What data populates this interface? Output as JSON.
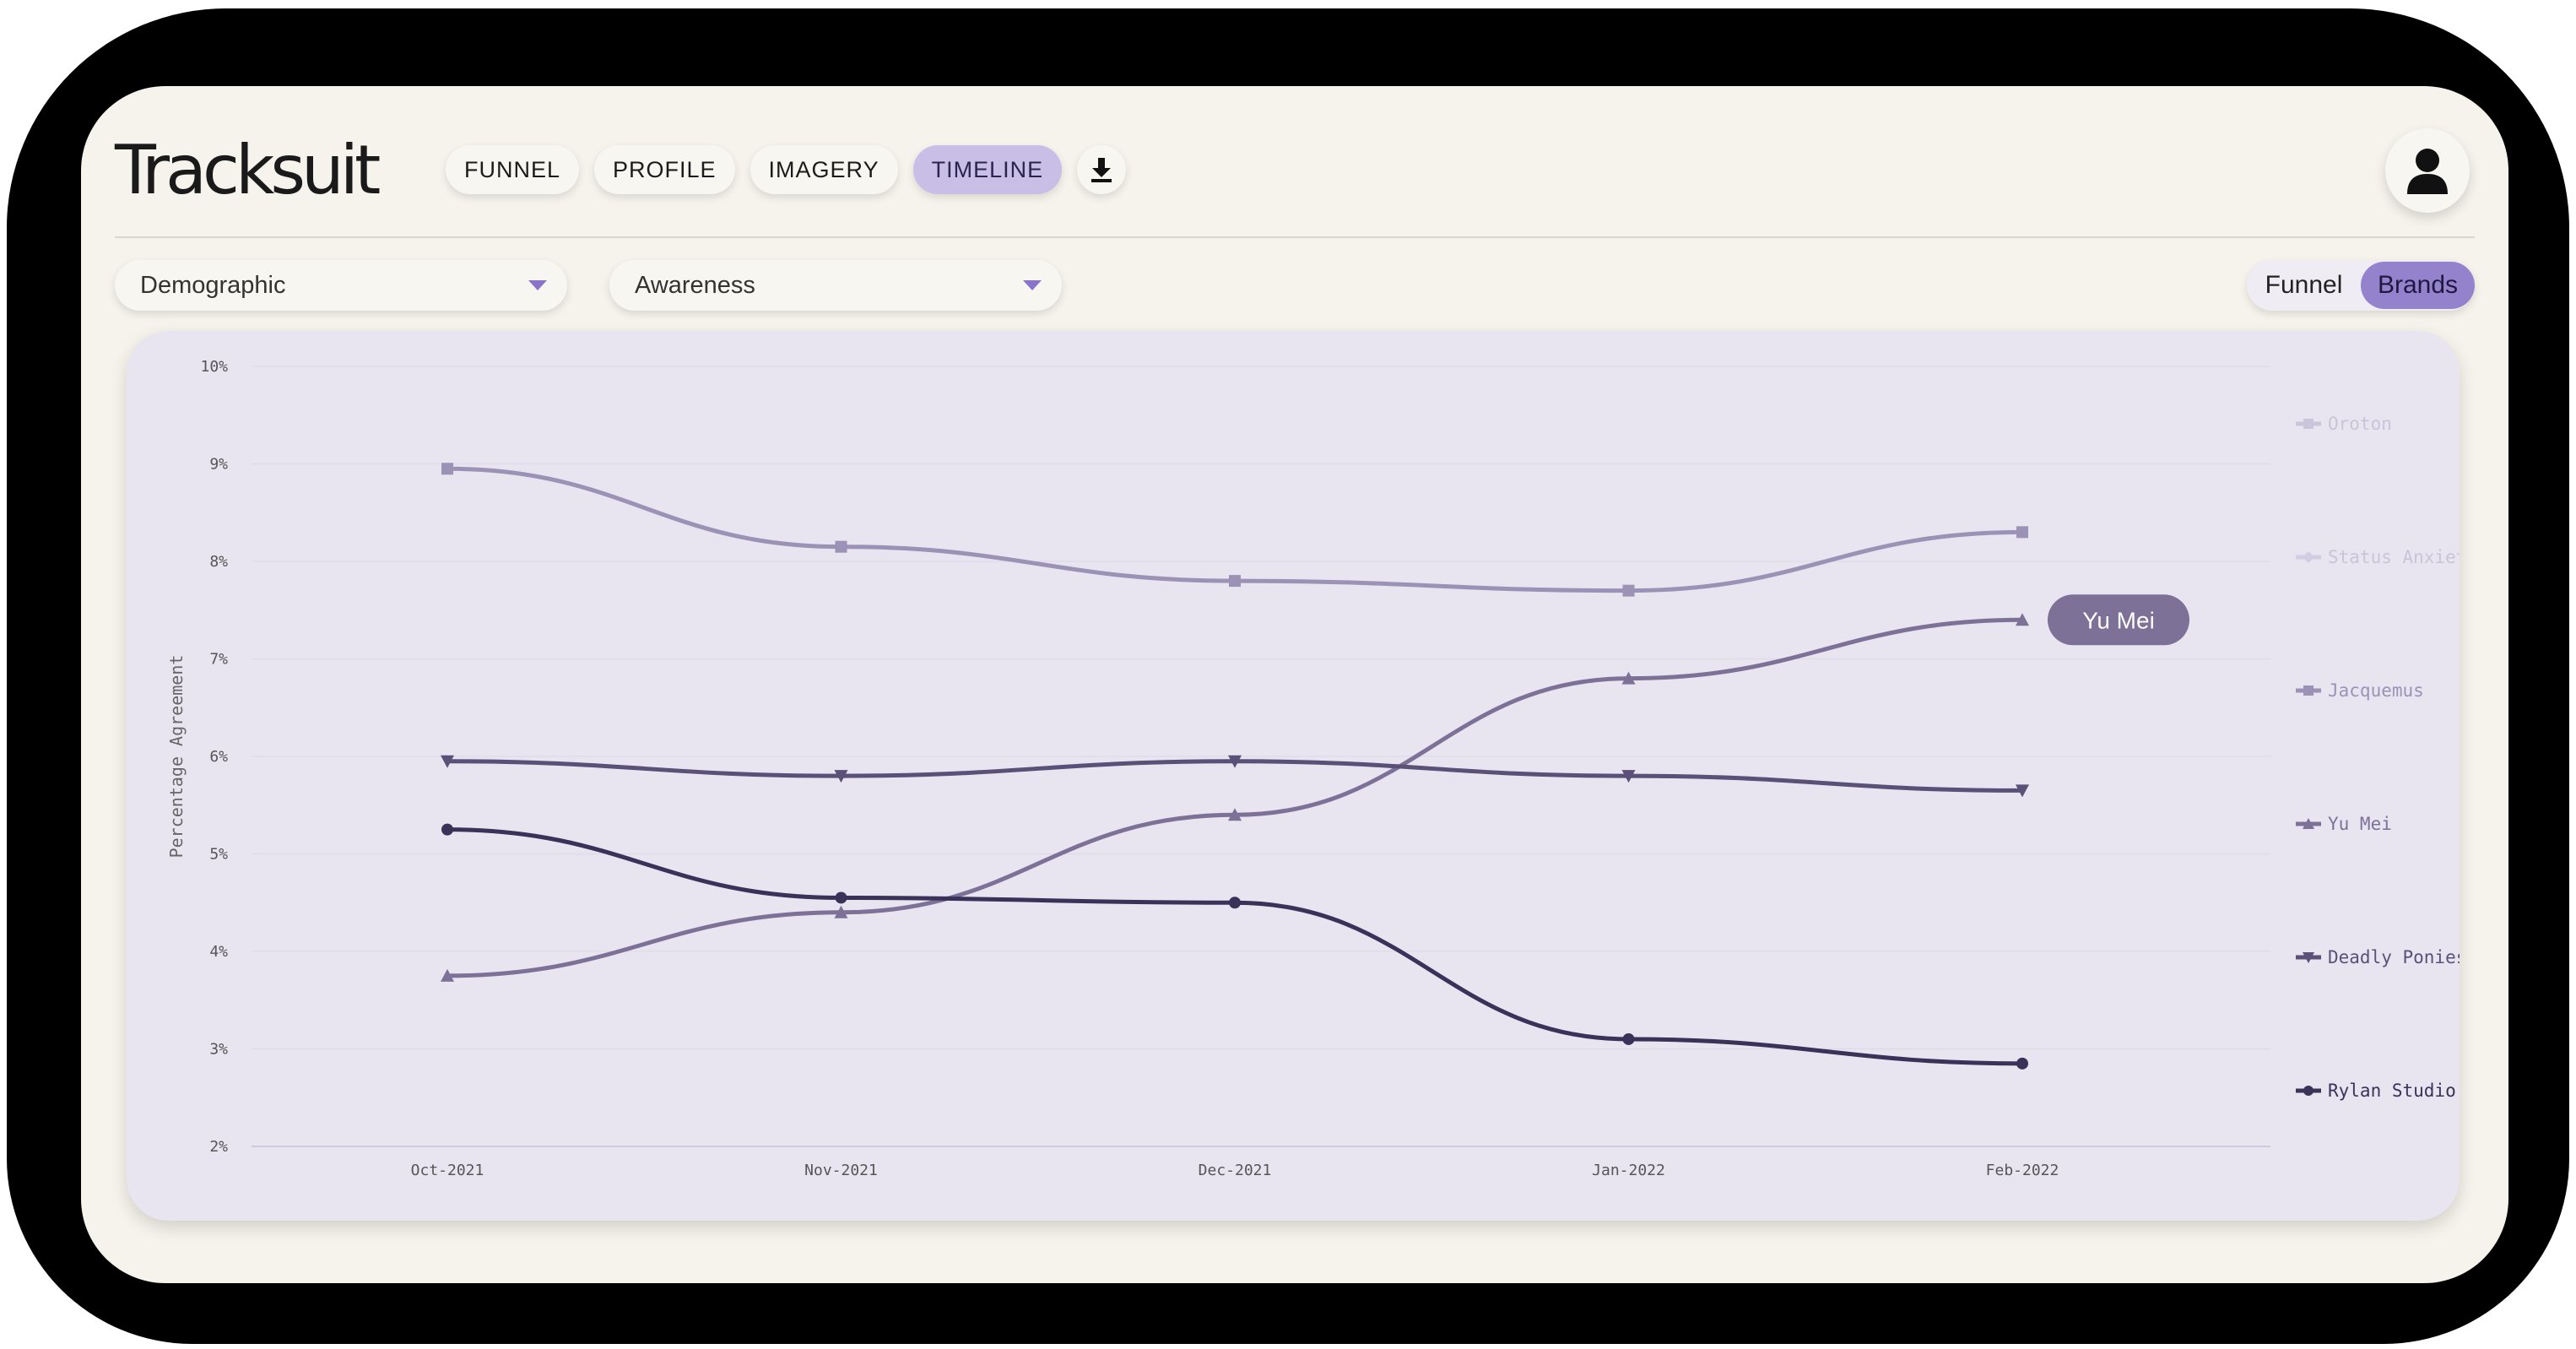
{
  "app": {
    "logo": "Tracksuit"
  },
  "nav": {
    "tabs": [
      {
        "label": "FUNNEL",
        "active": false
      },
      {
        "label": "PROFILE",
        "active": false
      },
      {
        "label": "IMAGERY",
        "active": false
      },
      {
        "label": "TIMELINE",
        "active": true
      }
    ],
    "download_icon": "download-icon",
    "user_icon": "user-icon"
  },
  "filters": {
    "demographic": "Demographic",
    "metric": "Awareness"
  },
  "view_toggle": {
    "options": [
      "Funnel",
      "Brands"
    ],
    "selected": "Brands"
  },
  "colors": {
    "accent": "#9483cc",
    "active_tab": "#c8bee6",
    "background": "#f6f3ec",
    "card": "#e8e5f0"
  },
  "chart_data": {
    "type": "line",
    "ylabel": "Percentage Agreement",
    "xlabel": "",
    "ylim": [
      2,
      10
    ],
    "yticks": [
      "10%",
      "9%",
      "8%",
      "7%",
      "6%",
      "5%",
      "4%",
      "3%",
      "2%"
    ],
    "categories": [
      "Oct-2021",
      "Nov-2021",
      "Dec-2021",
      "Jan-2022",
      "Feb-2022"
    ],
    "legend_placement": "right",
    "tooltip": {
      "label": "Yu Mei",
      "series": "Yu Mei",
      "category": "Feb-2022"
    },
    "series": [
      {
        "name": "Oroton",
        "values": [],
        "color": "#cbc5dc",
        "marker": "square",
        "faded": true
      },
      {
        "name": "Status Anxiety",
        "values": [],
        "color": "#d2cde2",
        "marker": "diamond",
        "faded": true
      },
      {
        "name": "Jacquemus",
        "values": [
          8.95,
          8.15,
          7.8,
          7.7,
          8.3
        ],
        "color": "#9c92b6",
        "marker": "square",
        "faded": false
      },
      {
        "name": "Yu Mei",
        "values": [
          3.75,
          4.4,
          5.4,
          6.8,
          7.4
        ],
        "color": "#7d7198",
        "marker": "triangle",
        "faded": false
      },
      {
        "name": "Deadly Ponies",
        "values": [
          5.95,
          5.8,
          5.95,
          5.8,
          5.65
        ],
        "color": "#5a5078",
        "marker": "triangle-down",
        "faded": false
      },
      {
        "name": "Rylan Studio",
        "values": [
          5.25,
          4.55,
          4.5,
          3.1,
          2.85
        ],
        "color": "#3a3258",
        "marker": "circle",
        "faded": false
      }
    ]
  }
}
